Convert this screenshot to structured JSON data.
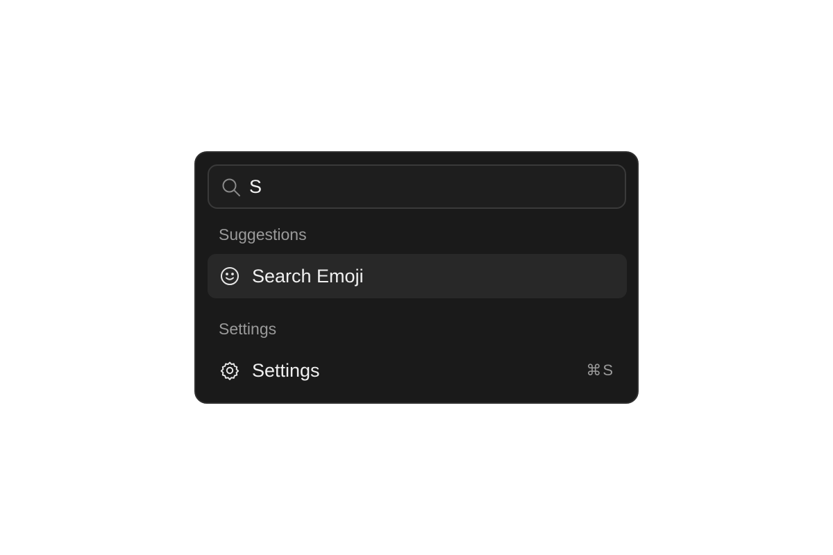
{
  "search": {
    "value": "S",
    "icon": "search-icon"
  },
  "groups": [
    {
      "heading": "Suggestions",
      "items": [
        {
          "label": "Search Emoji",
          "icon": "smiley-icon",
          "selected": true
        }
      ]
    },
    {
      "heading": "Settings",
      "items": [
        {
          "label": "Settings",
          "icon": "gear-icon",
          "shortcut": "⌘S",
          "selected": false
        }
      ]
    }
  ],
  "colors": {
    "panel_background": "#1a1a1a",
    "selected_background": "#282828",
    "text_primary": "#f0f0f0",
    "text_secondary": "#9a9a9a",
    "page_background": "#ffffff"
  }
}
